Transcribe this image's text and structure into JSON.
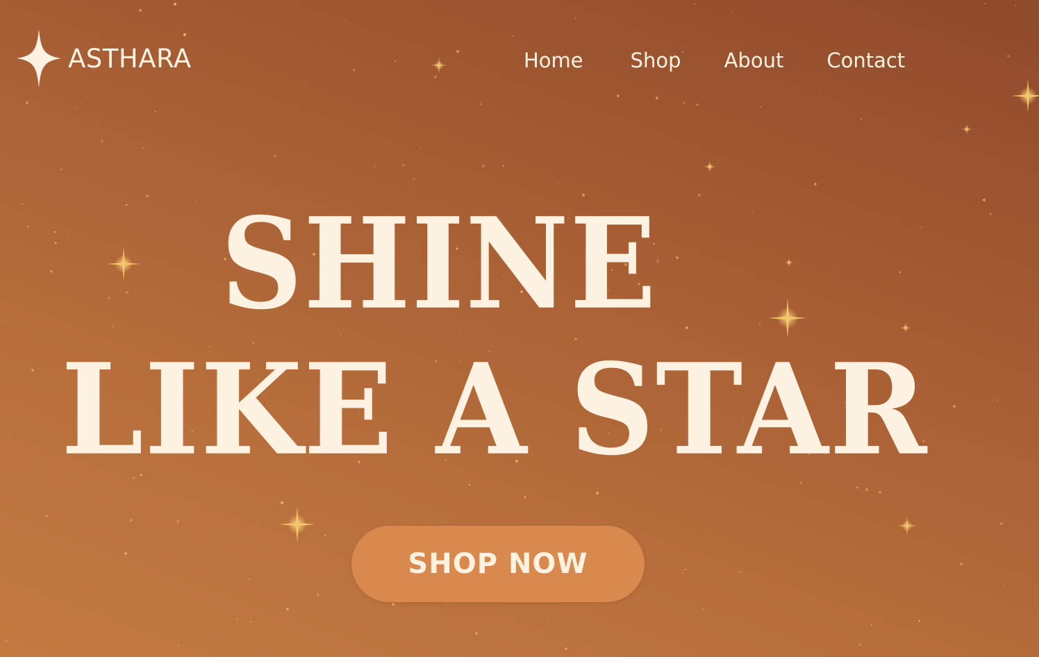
{
  "brand": {
    "name": "ASTHARA",
    "logo_icon": "four-point-star-icon"
  },
  "nav": {
    "items": [
      {
        "label": "Home"
      },
      {
        "label": "Shop"
      },
      {
        "label": "About"
      },
      {
        "label": "Contact"
      }
    ]
  },
  "hero": {
    "title_line_1": "SHINE",
    "title_line_2": "LIKE A STAR",
    "cta_label": "SHOP NOW",
    "decoration_icon": "sparkle-icon"
  },
  "colors": {
    "background_top": "#8f4a2c",
    "background_bottom": "#c27a41",
    "text": "#fdf1e2",
    "cta_background": "#d9894d",
    "sparkle": "#f7c766"
  }
}
